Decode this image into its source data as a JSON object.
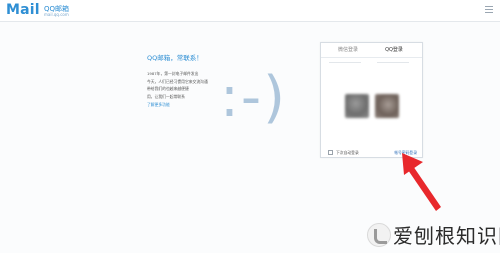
{
  "header": {
    "logo_text": "Mail",
    "brand": "QQ邮箱",
    "domain": "mail.qq.com"
  },
  "welcome": {
    "title": "QQ邮箱，常联系！",
    "lines": [
      "1987年，第一封电子邮件发出",
      "今天，人们已经习惯用它来交流沟通",
      "带给我们的也越来越便捷",
      "用，让我们一起常联系"
    ],
    "link": "了解更多功能"
  },
  "smiley": ":-)",
  "login": {
    "tabs": [
      "微信登录",
      "QQ登录"
    ],
    "active_tab": "QQ登录",
    "remember_label": "下次自动登录",
    "help_link": "帐号密码登录"
  },
  "annotation": {
    "arrow_color": "#e8282c"
  },
  "watermark": {
    "text": "爱刨根知识网"
  }
}
